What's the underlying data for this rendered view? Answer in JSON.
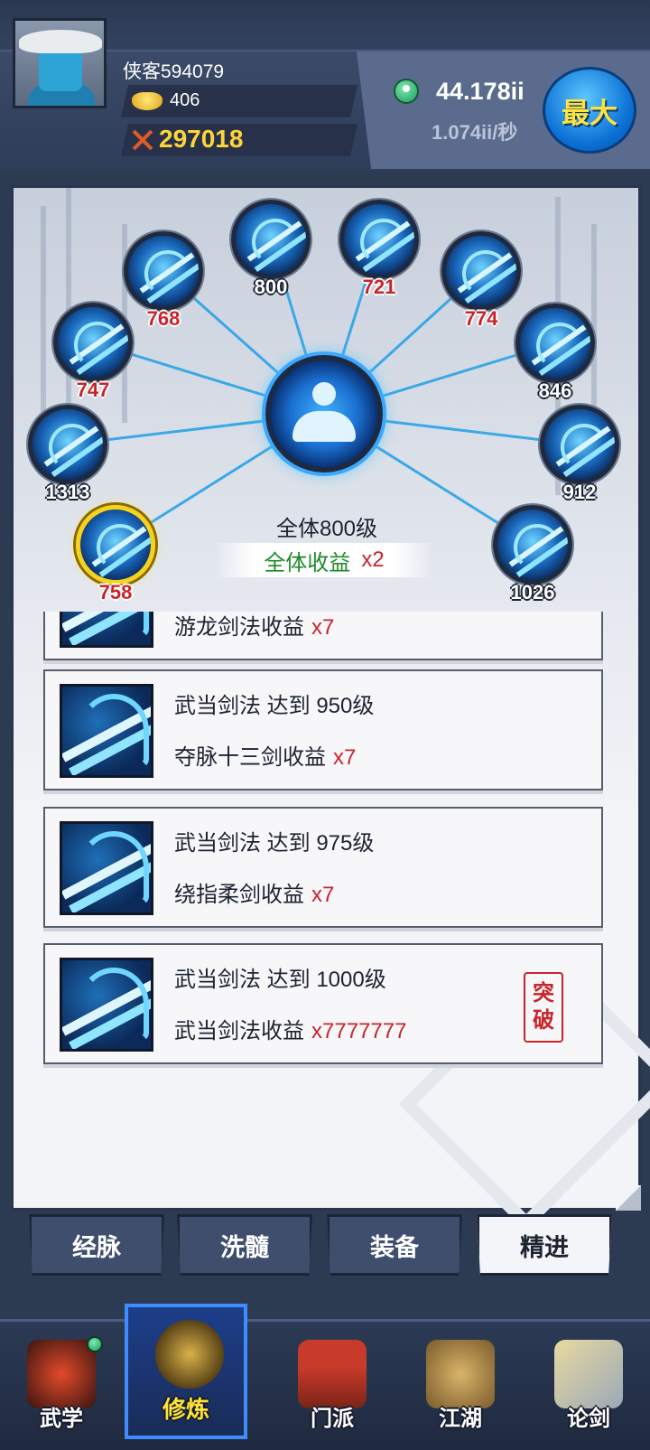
{
  "player": {
    "name": "侠客594079",
    "gold": "406",
    "power": "297018"
  },
  "currency": {
    "amount": "44.178ii",
    "rate": "1.074ii/秒",
    "max_button": "最大"
  },
  "tree": {
    "center_icon": "meditation-icon",
    "total_level": "全体800级",
    "bonus_label": "全体收益",
    "bonus_value": "x2",
    "nodes": [
      {
        "level": "758",
        "highlight": "red",
        "selected": true
      },
      {
        "level": "1313",
        "highlight": "white",
        "selected": false
      },
      {
        "level": "747",
        "highlight": "red",
        "selected": false
      },
      {
        "level": "768",
        "highlight": "red",
        "selected": false
      },
      {
        "level": "800",
        "highlight": "white",
        "selected": false
      },
      {
        "level": "721",
        "highlight": "red",
        "selected": false
      },
      {
        "level": "774",
        "highlight": "red",
        "selected": false
      },
      {
        "level": "846",
        "highlight": "white",
        "selected": false
      },
      {
        "level": "912",
        "highlight": "white",
        "selected": false
      },
      {
        "level": "1026",
        "highlight": "white",
        "selected": false
      }
    ]
  },
  "achievements": [
    {
      "title": "",
      "desc": "游龙剑法收益",
      "mult": "x7"
    },
    {
      "title": "武当剑法 达到 950级",
      "desc": "夺脉十三剑收益",
      "mult": "x7"
    },
    {
      "title": "武当剑法 达到 975级",
      "desc": "绕指柔剑收益",
      "mult": "x7"
    },
    {
      "title": "武当剑法 达到 1000级",
      "desc": "武当剑法收益",
      "mult": "x7777777",
      "badge": [
        "突",
        "破"
      ]
    }
  ],
  "sub_tabs": [
    {
      "label": "经脉",
      "active": false
    },
    {
      "label": "洗髓",
      "active": false
    },
    {
      "label": "装备",
      "active": false
    },
    {
      "label": "精进",
      "active": true
    }
  ],
  "bottom_nav": [
    {
      "label": "武学",
      "icon": "masked-fighter-icon",
      "active": false,
      "badge": true
    },
    {
      "label": "修炼",
      "icon": "meditating-figure-icon",
      "active": true,
      "badge": false
    },
    {
      "label": "门派",
      "icon": "temple-icon",
      "active": false,
      "badge": false
    },
    {
      "label": "江湖",
      "icon": "gourd-scroll-icon",
      "active": false,
      "badge": false
    },
    {
      "label": "论剑",
      "icon": "crossed-swords-icon",
      "active": false,
      "badge": false
    }
  ],
  "colors": {
    "accent_red": "#c8242a",
    "accent_green": "#1f8a2a",
    "gold_text": "#ffd33a",
    "nav_active": "#3f8cff"
  }
}
